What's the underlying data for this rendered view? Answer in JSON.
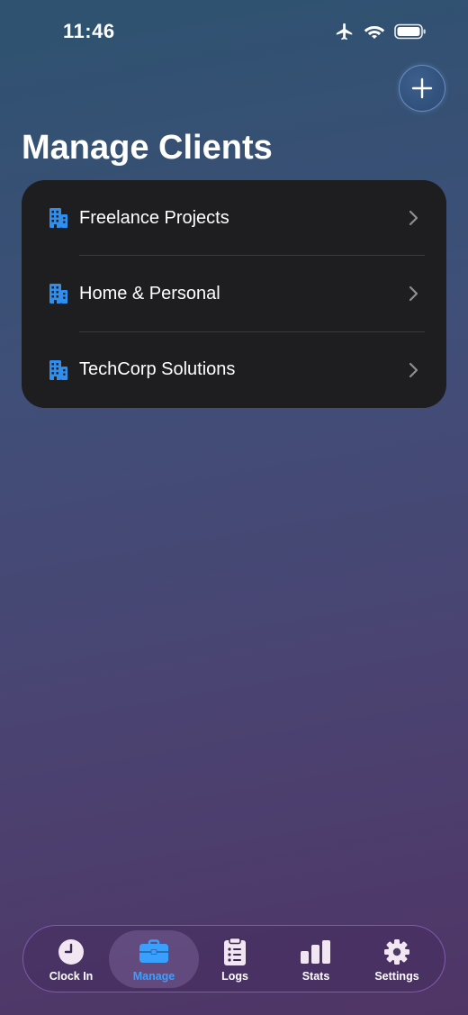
{
  "status_bar": {
    "time": "11:46"
  },
  "header": {
    "title": "Manage Clients",
    "add_icon": "plus-icon"
  },
  "clients": [
    {
      "name": "Freelance Projects",
      "icon": "building-icon"
    },
    {
      "name": "Home & Personal",
      "icon": "building-icon"
    },
    {
      "name": "TechCorp Solutions",
      "icon": "building-icon"
    }
  ],
  "tabs": [
    {
      "label": "Clock In",
      "icon": "clock-icon",
      "active": false
    },
    {
      "label": "Manage",
      "icon": "briefcase-icon",
      "active": true
    },
    {
      "label": "Logs",
      "icon": "clipboard-list-icon",
      "active": false
    },
    {
      "label": "Stats",
      "icon": "bar-chart-icon",
      "active": false
    },
    {
      "label": "Settings",
      "icon": "gear-icon",
      "active": false
    }
  ],
  "colors": {
    "accent": "#3aa0ff",
    "card_background": "#1e1e20",
    "building_icon": "#2f8ff0"
  }
}
